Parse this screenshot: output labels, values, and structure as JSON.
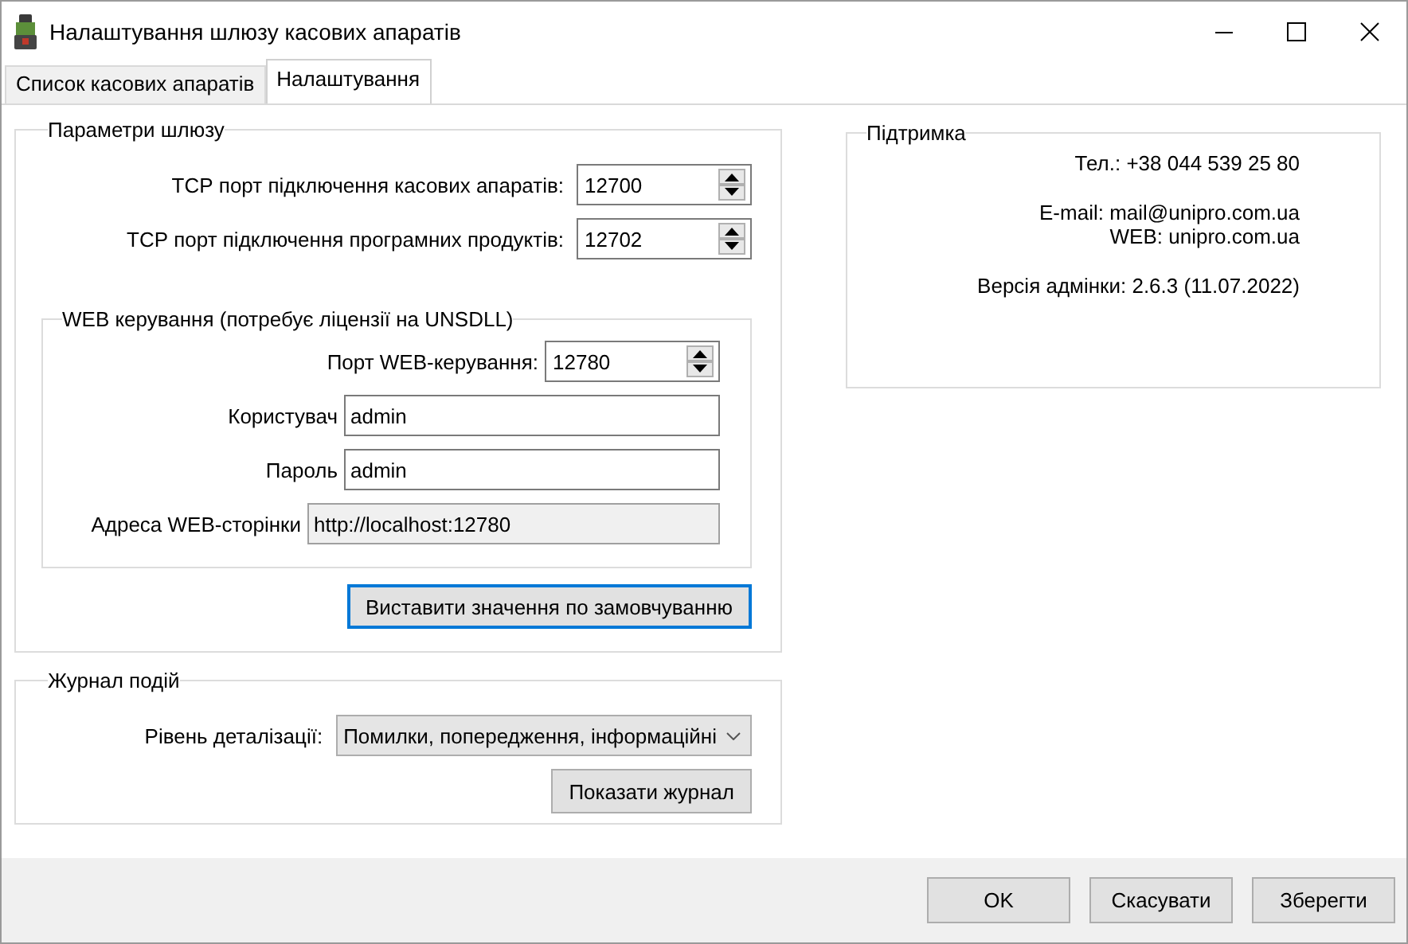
{
  "window": {
    "title": "Налаштування шлюзу касових апаратів"
  },
  "tabs": [
    {
      "label": "Список касових апаратів",
      "selected": false
    },
    {
      "label": "Налаштування",
      "selected": true
    }
  ],
  "gateway": {
    "title": "Параметри шлюзу",
    "ports": [
      {
        "label": "ТСР порт підключення касових апаратів:",
        "value": "12700"
      },
      {
        "label": "ТСР порт підключення програмних продуктів:",
        "value": "12702"
      }
    ],
    "web": {
      "title": "WEB керування (потребує ліцензії на UNSDLL)",
      "port": {
        "label": "Порт WEB-керування:",
        "value": "12780"
      },
      "fields": [
        {
          "label": "Користувач",
          "value": "admin",
          "readonly": false
        },
        {
          "label": "Пароль",
          "value": "admin",
          "readonly": false
        },
        {
          "label": "Адреса WEB-сторінки",
          "value": "http://localhost:12780",
          "readonly": true
        }
      ]
    },
    "reset_button": {
      "label": "Виставити значення по замовчуванню",
      "focused": true
    }
  },
  "log": {
    "title": "Журнал подій",
    "level_label": "Рівень деталізації:",
    "level_value": "Помилки, попередження, інформаційні",
    "show_button": "Показати журнал"
  },
  "support": {
    "title": "Підтримка",
    "groups": [
      [
        "Тел.: +38 044 539 25 80"
      ],
      [
        "E-mail: mail@unipro.com.ua",
        "WEB: unipro.com.ua"
      ],
      [
        "Версія адмінки: 2.6.3  (11.07.2022)"
      ]
    ]
  },
  "buttons": [
    "OK",
    "Скасувати",
    "Зберегти"
  ]
}
